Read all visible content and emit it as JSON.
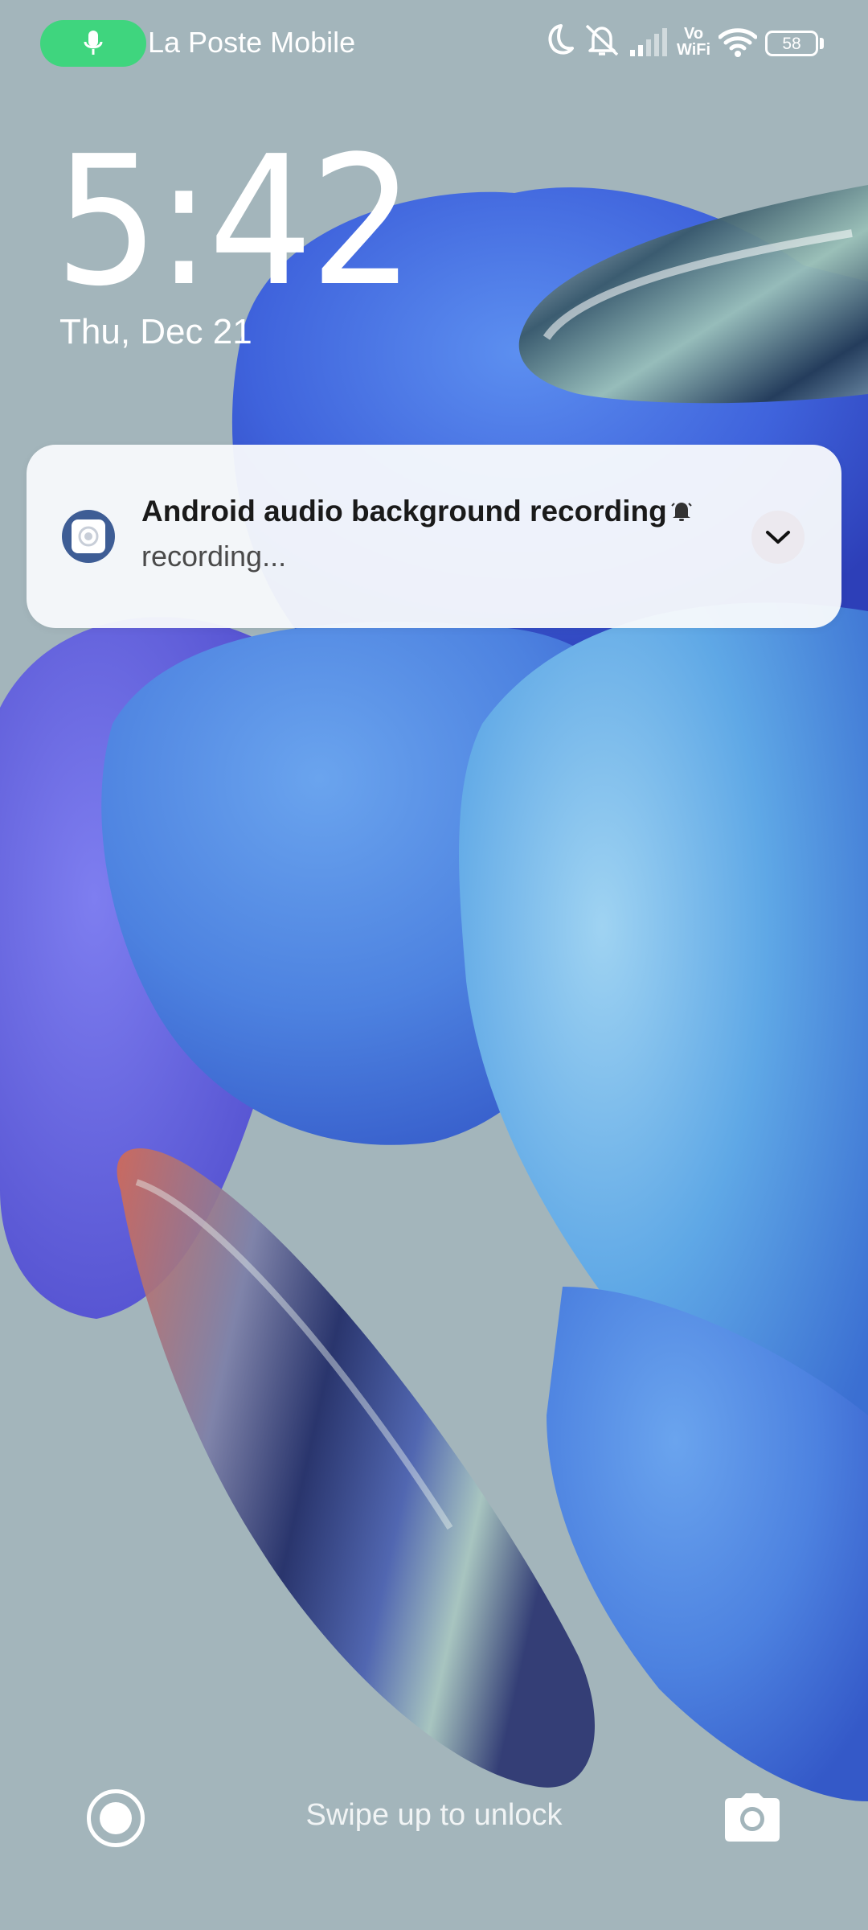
{
  "status_bar": {
    "carrier": "La Poste Mobile",
    "vowifi_top": "Vo",
    "vowifi_bottom": "WiFi",
    "battery_level": "58",
    "icons": [
      "mic-icon",
      "moon-icon",
      "bell-off-icon",
      "signal-icon",
      "vowifi-icon",
      "wifi-icon",
      "battery-icon"
    ]
  },
  "lock_screen": {
    "time": "5:42",
    "date": "Thu, Dec 21"
  },
  "notification": {
    "title": "Android audio background recording",
    "text": "recording...",
    "app_icon": "recorder-app-icon",
    "alert_icon": "bell-icon",
    "expand_icon": "chevron-down-icon"
  },
  "bottom_bar": {
    "unlock_hint": "Swipe up to unlock",
    "left_icon": "assistant-icon",
    "right_icon": "camera-icon"
  },
  "colors": {
    "mic_pill": "#3fd57e",
    "background": "#a3b5bb",
    "notification_bg": "#f8fafc",
    "app_icon_bg": "#3e5d95"
  }
}
